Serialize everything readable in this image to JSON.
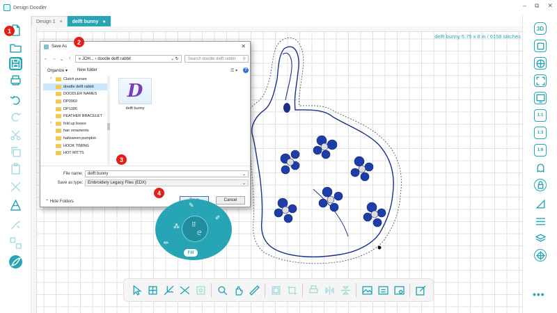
{
  "app": {
    "title": "Design Doodler",
    "window_controls": [
      "–",
      "⧉",
      "✕"
    ]
  },
  "tabs": [
    {
      "label": "Design 1",
      "close": "×",
      "active": false
    },
    {
      "label": "delft bunny",
      "close": "●",
      "active": true
    }
  ],
  "canvas": {
    "info": "delft bunny   5.75 x 8 in / 6158 stitches"
  },
  "badges": [
    "1",
    "2",
    "3",
    "4"
  ],
  "left_toolbar": [
    "new-icon",
    "open-icon",
    "save-icon",
    "print-icon",
    "undo-icon",
    "redo-icon",
    "cut-icon",
    "copy-icon",
    "paste-icon",
    "delete-icon",
    "text-icon",
    "draw-icon",
    "transform-icon",
    "stitch-icon"
  ],
  "right_toolbar": [
    "3D",
    "square-icon",
    "grid-icon",
    "fit-icon",
    "monitor-icon",
    "1:1",
    "1:3",
    "1:6",
    "ghost-icon",
    "lock-icon",
    "layers-icon",
    "align-icon",
    "stack-icon",
    "hoop-icon"
  ],
  "right_more": "•••",
  "dialog": {
    "title": "Save As",
    "close": "✕",
    "path_prefix": "« JOH...",
    "path_sep": "›",
    "path_current": "doodle delft rabbit",
    "search_placeholder": "Search doodle delft rabbit",
    "organize": "Organize ▾",
    "new_folder": "New folder",
    "view": "☰ ▾",
    "help": "?",
    "folders": [
      {
        "name": "Clutch purses",
        "expandable": true,
        "selected": false
      },
      {
        "name": "doodle delft rabbit",
        "expandable": false,
        "selected": true
      },
      {
        "name": "DOODLER NAMES",
        "expandable": false,
        "selected": false
      },
      {
        "name": "DP0969",
        "expandable": false,
        "selected": false
      },
      {
        "name": "DP1395",
        "expandable": false,
        "selected": false
      },
      {
        "name": "FEATHER BRACELET",
        "expandable": false,
        "selected": false
      },
      {
        "name": "fold up boxes",
        "expandable": true,
        "selected": false
      },
      {
        "name": "hair ornaments",
        "expandable": false,
        "selected": false
      },
      {
        "name": "halloween pumpkin",
        "expandable": false,
        "selected": false
      },
      {
        "name": "HOOK TIMING",
        "expandable": false,
        "selected": false
      },
      {
        "name": "HOT MITTS",
        "expandable": false,
        "selected": false
      }
    ],
    "file": {
      "thumb_letter": "D",
      "caption": "delft bunny"
    },
    "file_name_label": "File name:",
    "file_name_value": "delft bunny",
    "save_type_label": "Save as type:",
    "save_type_value": "Embroidery Legacy Files (EDX)",
    "hide_folders": "⌃  Hide Folders",
    "save": "Save",
    "cancel": "Cancel"
  },
  "radial_menu": {
    "fill": "Fill"
  },
  "bottom_toolbar": [
    "select-icon",
    "node-edit-icon",
    "split-icon",
    "scissors-icon",
    "rect-select-icon",
    "zoom-icon",
    "pan-icon",
    "measure-icon",
    "frame-icon",
    "crop-icon",
    "print-icon",
    "mirror-v-icon",
    "mirror-h-icon",
    "image-icon",
    "image-edit-icon",
    "image-trace-icon",
    "edit-icon"
  ],
  "colors": {
    "accent": "#27a5b5",
    "badge": "#e2201a",
    "stitch": "#1b2f85"
  }
}
